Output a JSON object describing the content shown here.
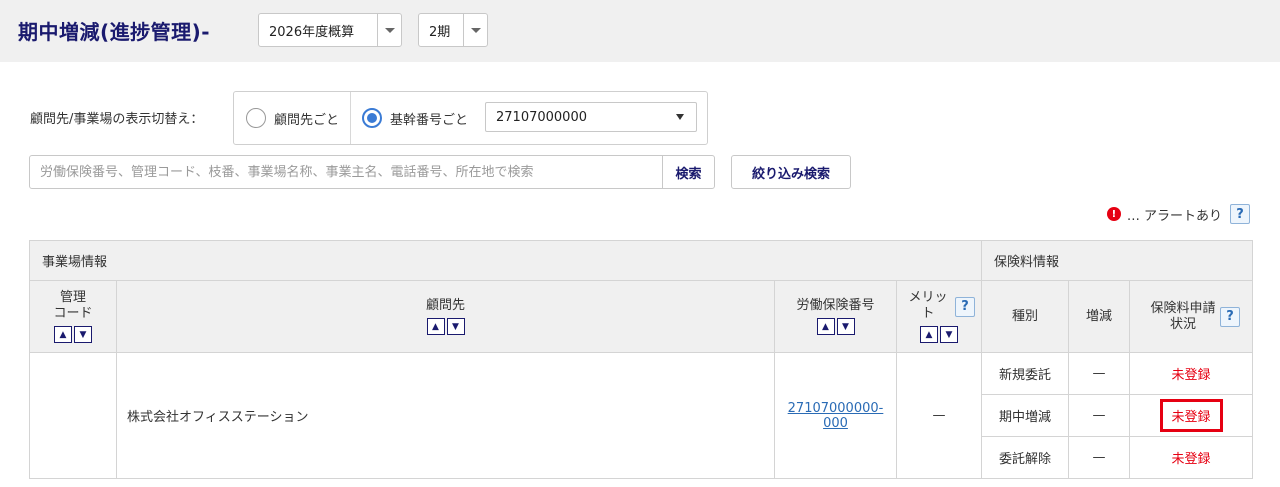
{
  "header": {
    "title": "期中増減(進捗管理)-",
    "year_select": "2026年度概算",
    "period_select": "2期"
  },
  "display_switch": {
    "label": "顧問先/事業場の表示切替え：",
    "option_client": "顧問先ごと",
    "option_base": "基幹番号ごと",
    "base_code_value": "27107000000"
  },
  "search": {
    "placeholder": "労働保険番号、管理コード、枝番、事業場名称、事業主名、電話番号、所在地で検索",
    "search_label": "検索",
    "filter_label": "絞り込み検索"
  },
  "legend": {
    "alert_icon": "!",
    "alert_text": "… アラートあり",
    "help_icon": "?"
  },
  "table": {
    "group_office": "事業場情報",
    "group_premium": "保険料情報",
    "col_code_line1": "管理",
    "col_code_line2": "コード",
    "col_client": "顧問先",
    "col_labor_no": "労働保険番号",
    "col_merit_line1": "メリッ",
    "col_merit_line2": "ト",
    "col_type": "種別",
    "col_change": "増減",
    "col_status_line1": "保険料申請",
    "col_status_line2": "状況",
    "sort_up": "▲",
    "sort_down": "▼",
    "client_name": "株式会社オフィスステーション",
    "labor_no_line1": "27107000000-",
    "labor_no_line2": "000",
    "merit_value": "—",
    "rows": [
      {
        "type": "新規委託",
        "change": "—",
        "status": "未登録"
      },
      {
        "type": "期中増減",
        "change": "—",
        "status": "未登録"
      },
      {
        "type": "委託解除",
        "change": "—",
        "status": "未登録"
      }
    ]
  },
  "colors": {
    "accent": "#1a1a6e",
    "alert": "#e60012",
    "link": "#2a6bb5"
  }
}
